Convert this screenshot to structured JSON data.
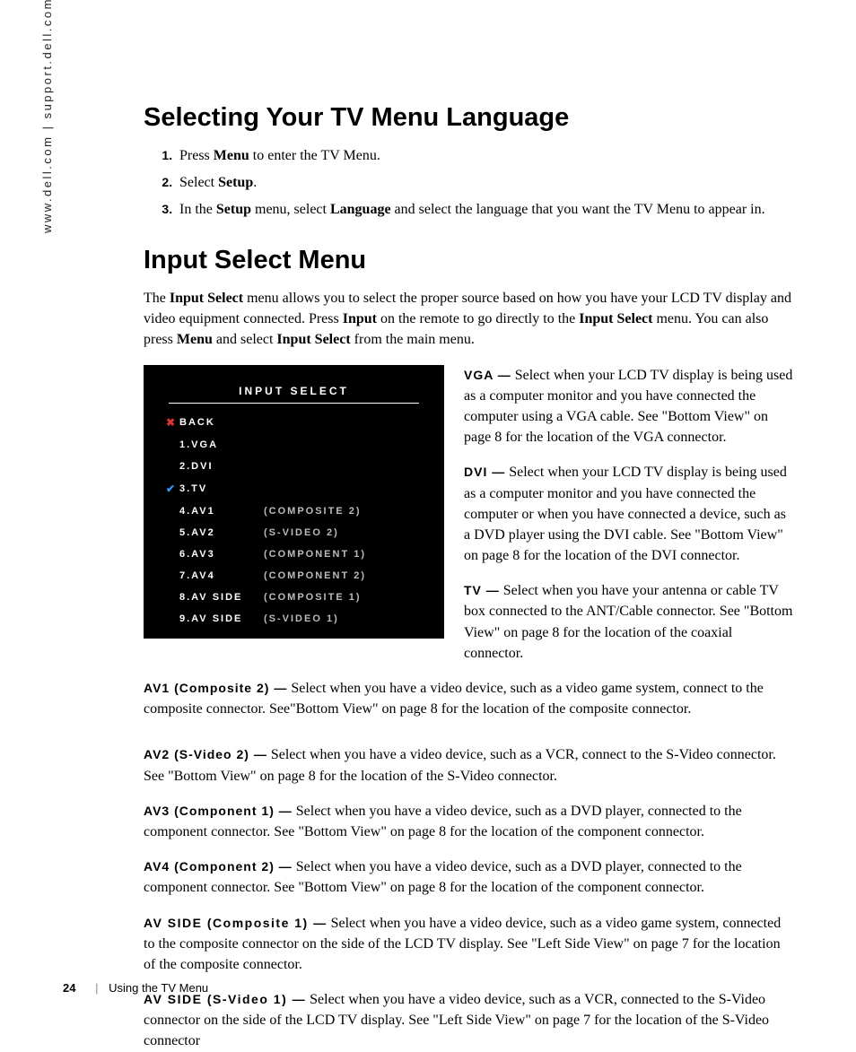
{
  "side_url": "www.dell.com | support.dell.com",
  "section1": {
    "title": "Selecting Your TV Menu Language",
    "steps": [
      {
        "pre": "Press ",
        "b1": "Menu",
        "post": " to enter the TV Menu."
      },
      {
        "pre": "Select ",
        "b1": "Setup",
        "post": "."
      },
      {
        "pre": "In the ",
        "b1": "Setup",
        "mid": " menu, select ",
        "b2": "Language",
        "post": " and select the language that you want the TV Menu to appear in."
      }
    ]
  },
  "section2": {
    "title": "Input Select Menu",
    "intro_parts": {
      "p1": "The ",
      "b1": "Input Select",
      "p2": " menu allows you to select the proper source based on how you have your LCD TV display and video equipment connected. Press ",
      "b2": "Input",
      "p3": " on the remote to go directly to the ",
      "b3": "Input Select",
      "p4": " menu. You can also press ",
      "b4": "Menu",
      "p5": " and select ",
      "b5": "Input Select",
      "p6": " from the main menu."
    }
  },
  "osd": {
    "title": "INPUT SELECT",
    "items": [
      {
        "icon": "✖",
        "iconClass": "red",
        "label": "BACK",
        "sub": ""
      },
      {
        "icon": "",
        "iconClass": "",
        "label": "1.VGA",
        "sub": ""
      },
      {
        "icon": "",
        "iconClass": "",
        "label": "2.DVI",
        "sub": ""
      },
      {
        "icon": "✔",
        "iconClass": "blue",
        "label": "3.TV",
        "sub": ""
      },
      {
        "icon": "",
        "iconClass": "",
        "label": "4.AV1",
        "sub": "(COMPOSITE 2)"
      },
      {
        "icon": "",
        "iconClass": "",
        "label": "5.AV2",
        "sub": "(S-VIDEO 2)"
      },
      {
        "icon": "",
        "iconClass": "",
        "label": "6.AV3",
        "sub": "(COMPONENT 1)"
      },
      {
        "icon": "",
        "iconClass": "",
        "label": "7.AV4",
        "sub": "(COMPONENT 2)"
      },
      {
        "icon": "",
        "iconClass": "",
        "label": "8.AV SIDE",
        "sub": "(COMPOSITE 1)"
      },
      {
        "icon": "",
        "iconClass": "",
        "label": "9.AV SIDE",
        "sub": "(S-VIDEO 1)"
      }
    ]
  },
  "descs": [
    {
      "term": "VGA —",
      "text": "  Select when your LCD TV display is being used as a computer monitor and you have connected the computer using a VGA cable. See \"Bottom View\" on page 8 for the location of the VGA connector."
    },
    {
      "term": "DVI —",
      "text": "  Select when your LCD TV display is being used as a computer monitor and you have connected the computer or when you have connected a device, such as a DVD player using the DVI cable. See \"Bottom View\" on page 8 for the location of the DVI connector."
    },
    {
      "term": "TV —",
      "text": "  Select when you have your antenna or cable TV box connected to the ANT/Cable connector. See \"Bottom View\" on page 8 for the location of the coaxial connector."
    },
    {
      "term": "AV1 (Composite 2) —",
      "text": "  Select when you have a video device, such as a video game system, connect to the composite connector.  See\"Bottom View\" on page 8 for the location of the composite connector."
    },
    {
      "term": "AV2 (S-Video 2) —",
      "text": "  Select when you have a video device, such as a VCR, connect to the S-Video connector.  See \"Bottom View\" on page 8 for the location of the S-Video connector."
    },
    {
      "term": "AV3 (Component 1) —",
      "text": "  Select when you have a video device, such as a DVD player, connected to the component connector. See \"Bottom View\" on page 8 for the location of the component connector."
    },
    {
      "term": "AV4 (Component 2) —",
      "text": "  Select when you have a video device, such as a DVD player, connected to the component connector. See \"Bottom View\" on page 8 for the location of the component connector."
    },
    {
      "term": "AV SIDE (Composite 1) —",
      "text": "  Select when you have a video device, such as a video game system, connected to the composite connector on the side of the LCD TV display. See \"Left Side View\" on page 7 for the location of the composite connector."
    },
    {
      "term": "AV SIDE (S-Video 1) —",
      "text": "  Select when you have a video device, such as a VCR, connected to the S-Video connector on the side of the LCD TV display. See \"Left Side View\" on page 7 for the location of the S-Video connector"
    }
  ],
  "footer": {
    "page": "24",
    "title": "Using the TV Menu"
  }
}
